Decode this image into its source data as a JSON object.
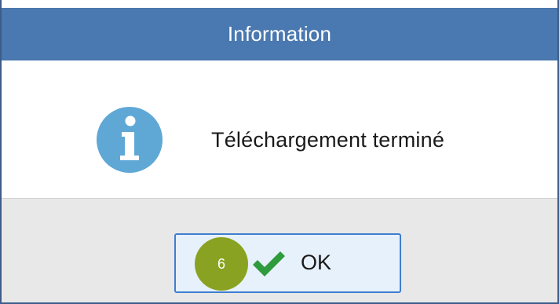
{
  "dialog": {
    "title": "Information",
    "message": "Téléchargement terminé",
    "icon": "info-icon",
    "ok_button": {
      "label": "OK",
      "icon": "check-icon",
      "step_badge": "6"
    }
  },
  "colors": {
    "title_bar": "#4a78b0",
    "info_icon": "#5fa8d6",
    "check_icon": "#2e9b3c",
    "step_badge": "#8aa221",
    "button_border": "#3f7ecf",
    "button_fill": "#e7f1fb",
    "footer": "#e8e8e8"
  }
}
